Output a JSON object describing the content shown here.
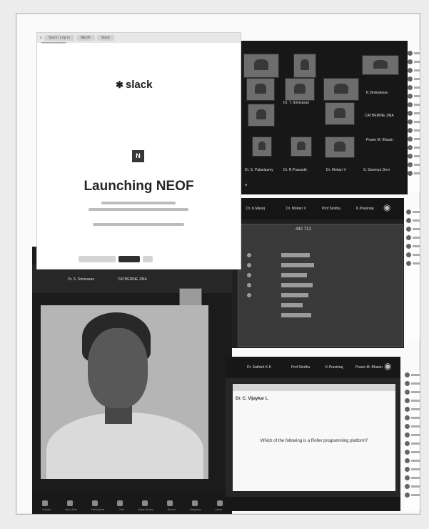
{
  "slack_window": {
    "tabs": [
      "Slack | Log in",
      "NEOF",
      "Slack"
    ],
    "logo_text": "slack",
    "workspace_initial": "N",
    "launch_title": "Launching NEOF",
    "buttons": [
      "Open in Browser",
      "Open Slack",
      "Cancel"
    ]
  },
  "video_grid_top": {
    "participant_names": [
      "K.Venkatesan",
      "Dr. T. Srinivasan",
      "CATHERINE JINA",
      "Dr. S. Palanisamy",
      "Dr. R.Prasanth",
      "Dr. Mohan V",
      "S. Sowmya Devi",
      "Pravin M. Bhasin"
    ]
  },
  "middle_window": {
    "tab_names": [
      "Dr. K.Manoj",
      "Dr. Mohan V",
      "Prof Sindhu",
      "K.Pravinraj"
    ],
    "window_title": "442 712"
  },
  "big_video": {
    "top_names": [
      "Dr. S. Srinivasan",
      "CATHERINE JINA"
    ],
    "toolbar": [
      "Unmute",
      "Stop Video",
      "Participants",
      "Chat",
      "Share Screen",
      "Record",
      "Reactions",
      "Leave"
    ]
  },
  "bottom_right_window": {
    "tab_names": [
      "Dr. Sathish K.K",
      "Prof Sindhu",
      "K.Pravinraj",
      "Pravin M. Bhasin"
    ],
    "doc_heading": "Dr. C. Vijaykar L",
    "question": "Which of the following is a Roller programming platform?"
  }
}
